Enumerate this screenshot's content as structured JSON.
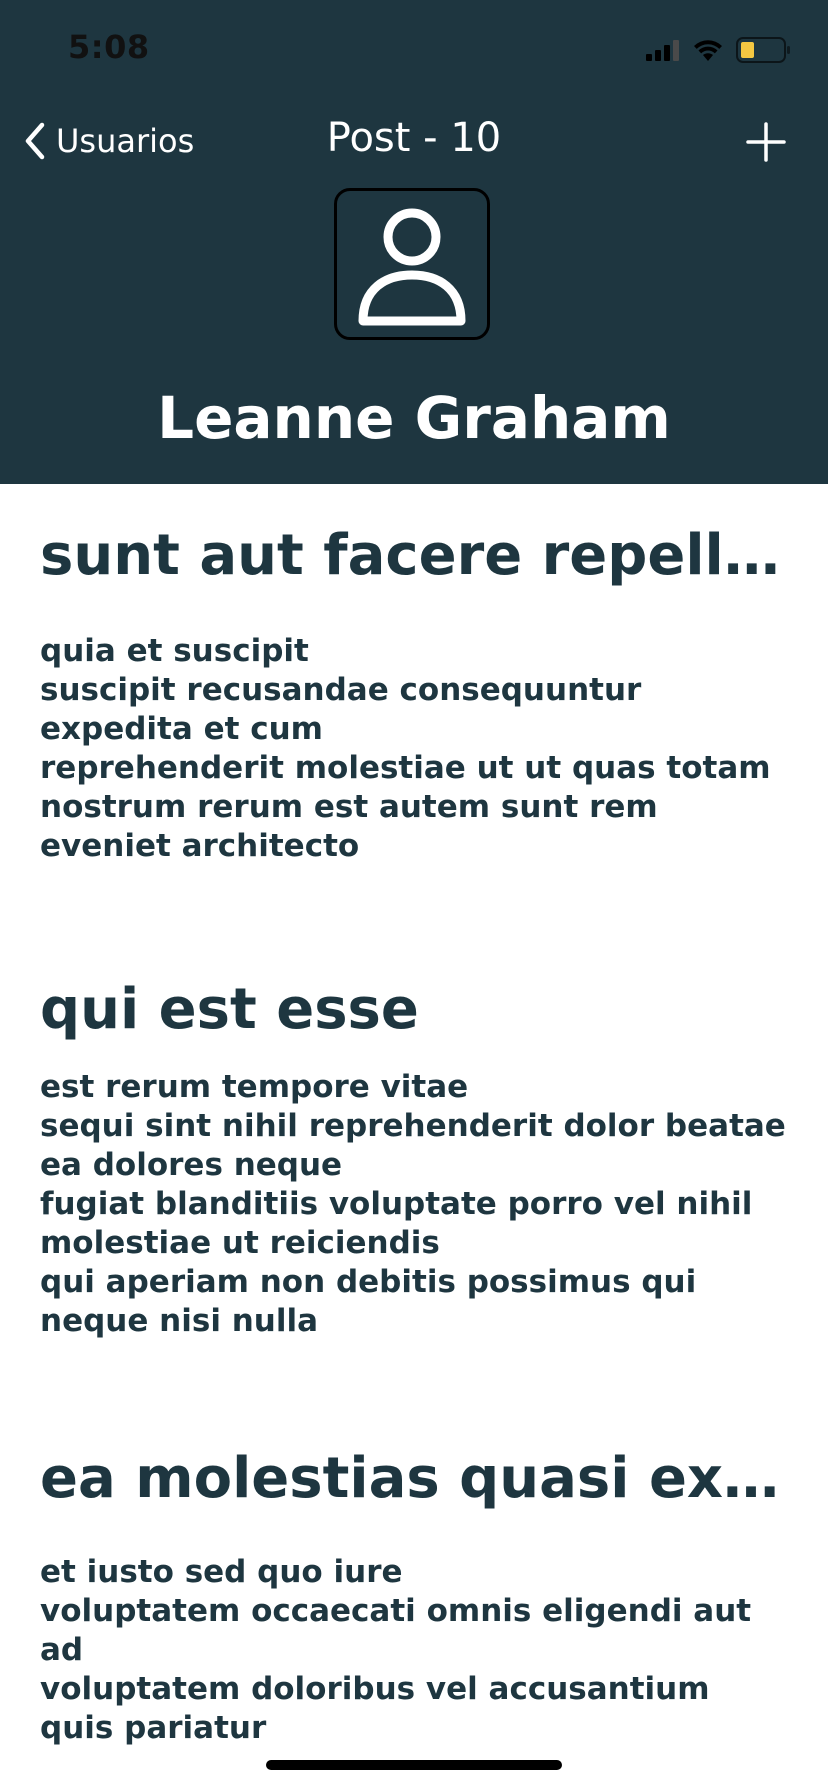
{
  "status_bar": {
    "time": "5:08"
  },
  "nav": {
    "back_label": "Usuarios",
    "title": "Post - 10",
    "add_icon": "plus-icon"
  },
  "profile": {
    "name": "Leanne Graham",
    "avatar_icon": "person-icon"
  },
  "colors": {
    "header_bg": "#1e3640",
    "text_dark": "#1e3640",
    "battery_fill": "#f5c842"
  },
  "posts": [
    {
      "title": "sunt aut facere repellat provident occaecati excepturi optio reprehenderit",
      "body": "quia et suscipit\nsuscipit recusandae consequuntur expedita et cum\nreprehenderit molestiae ut ut quas totam\nnostrum rerum est autem sunt rem\neveniet architecto"
    },
    {
      "title": "qui est esse",
      "body": "est rerum tempore vitae\nsequi sint nihil reprehenderit dolor beatae ea dolores neque\nfugiat blanditiis voluptate porro vel nihil molestiae ut reiciendis\nqui aperiam non debitis possimus qui neque nisi nulla"
    },
    {
      "title": "ea molestias quasi exercitationem repellat qui ipsa sit aut",
      "body": "et iusto sed quo iure\nvoluptatem occaecati omnis eligendi aut ad\nvoluptatem doloribus vel accusantium\nquis pariatur"
    }
  ]
}
